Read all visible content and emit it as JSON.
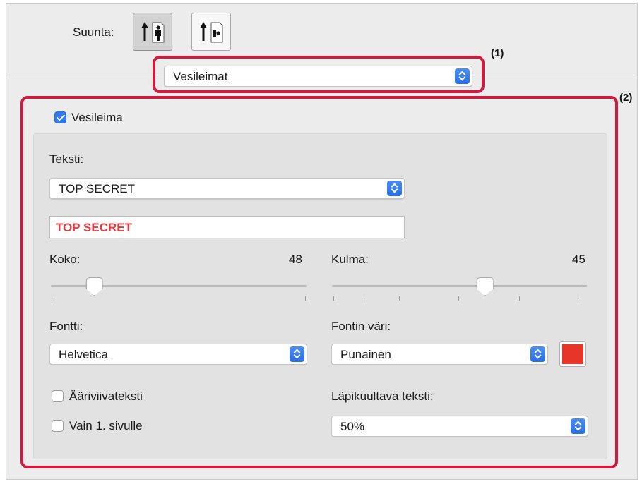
{
  "orientation": {
    "label": "Suunta:",
    "buttons": [
      {
        "name": "portrait",
        "selected": true
      },
      {
        "name": "landscape",
        "selected": false
      }
    ]
  },
  "panel_select": {
    "value": "Vesileimat"
  },
  "callouts": {
    "one": "(1)",
    "two": "(2)"
  },
  "watermark": {
    "enable_label": "Vesileima",
    "enabled": true,
    "text_label": "Teksti:",
    "text_select": "TOP SECRET",
    "text_field": "TOP SECRET",
    "size_label": "Koko:",
    "size_value": "48",
    "size_fraction": 0.17,
    "angle_label": "Kulma:",
    "angle_value": "45",
    "angle_fraction": 0.6,
    "font_label": "Fontti:",
    "font_value": "Helvetica",
    "color_label": "Fontin väri:",
    "color_value": "Punainen",
    "outline_label": "Ääriviivateksti",
    "outline_checked": false,
    "first_page_label": "Vain 1. sivulle",
    "first_page_checked": false,
    "transparency_label": "Läpikuultava teksti:",
    "transparency_value": "50%"
  },
  "colors": {
    "accent": "#2f7bf0",
    "highlight": "#d01a3f",
    "watermark_text": "#e8383d",
    "swatch": "#e8352a"
  }
}
